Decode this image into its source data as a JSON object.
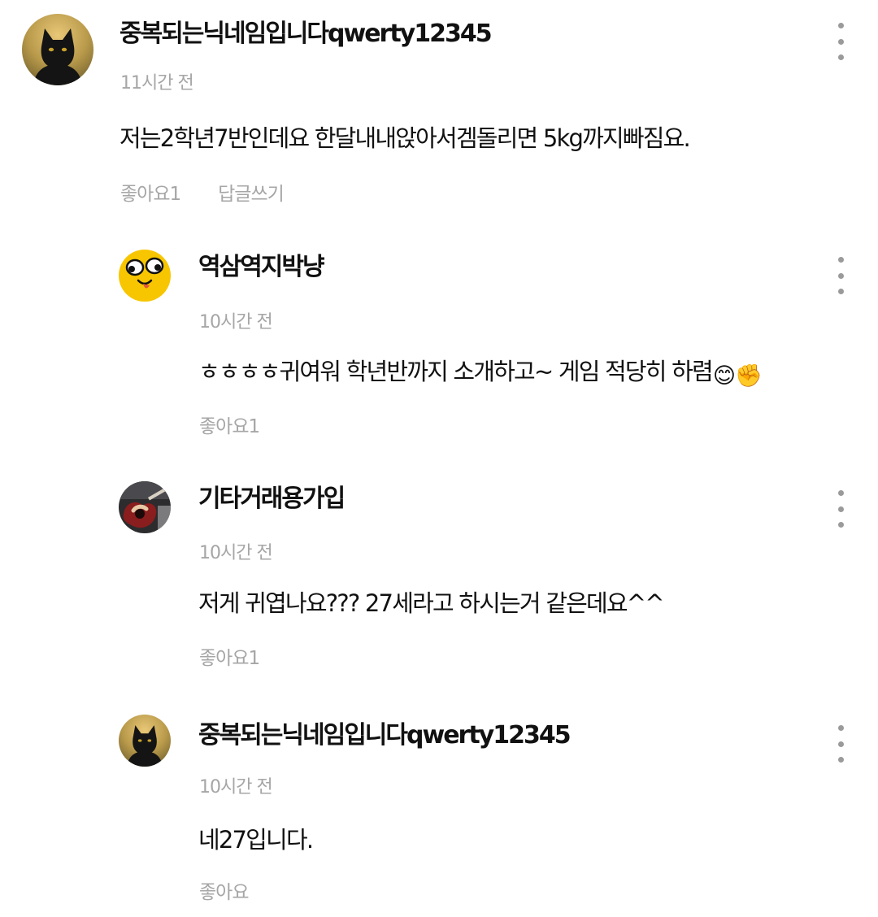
{
  "comments": [
    {
      "nickname": "중복되는닉네임입니다qwerty12345",
      "time": "11시간 전",
      "text": "저는2학년7반인데요 한달내내앉아서겜돌리면 5kg까지빠짐요.",
      "like_label": "좋아요1",
      "reply_label": "답글쓰기",
      "avatar_icon": "black-cat-avatar"
    },
    {
      "nickname": "역삼역지박냥",
      "time": "10시간 전",
      "text": "ㅎㅎㅎㅎ귀여워 학년반까지 소개하고~ 게임 적당히 하렴",
      "emojis": [
        "😊",
        "✊"
      ],
      "like_label": "좋아요1",
      "avatar_icon": "yellow-face-avatar"
    },
    {
      "nickname": "기타거래용가입",
      "time": "10시간 전",
      "text": "저게 귀엽나요??? 27세라고 하시는거 같은데요^^",
      "like_label": "좋아요1",
      "avatar_icon": "guitar-avatar"
    },
    {
      "nickname": "중복되는닉네임입니다qwerty12345",
      "time": "10시간 전",
      "text": "네27입니다.",
      "like_label": "좋아요",
      "avatar_icon": "black-cat-avatar"
    }
  ],
  "colors": {
    "text": "#111111",
    "meta": "#a6a6a6",
    "more_dots": "#9a9a9a",
    "yellow_avatar": "#f7c600"
  },
  "icons": {
    "more": "more-vertical-icon"
  }
}
